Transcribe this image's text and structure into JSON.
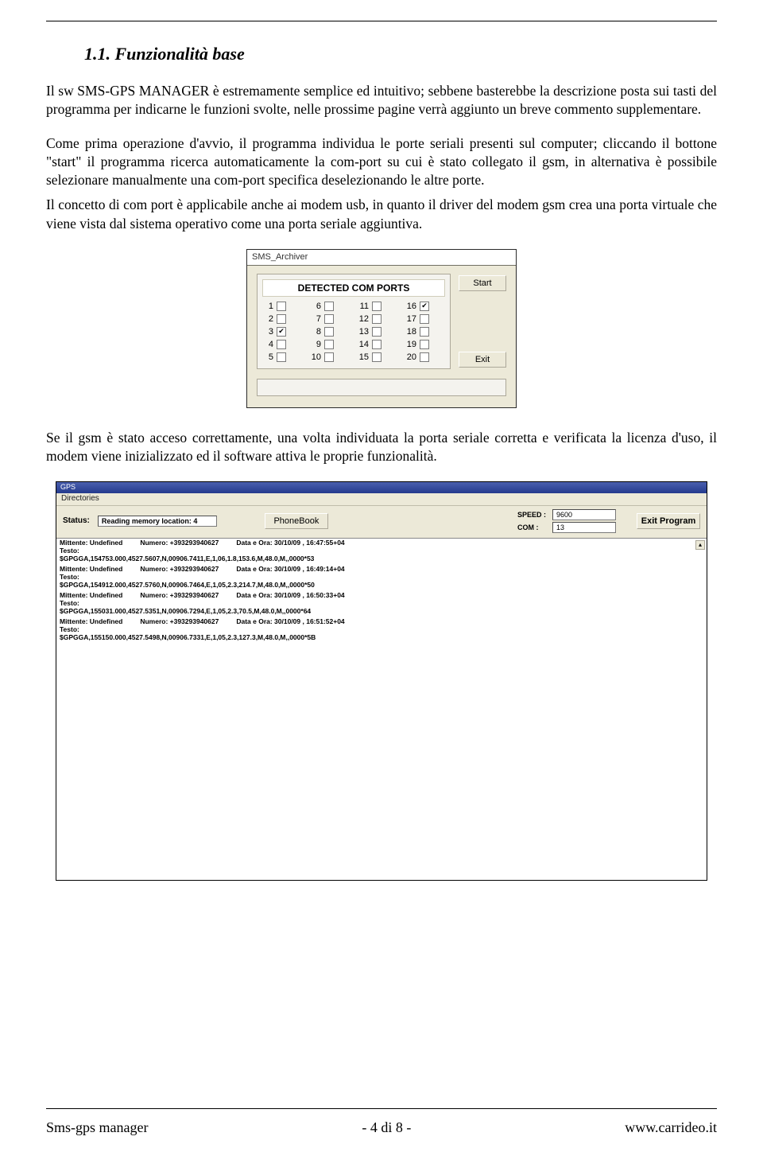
{
  "section": {
    "number": "1.1.",
    "title": "Funzionalità base"
  },
  "paragraphs": {
    "p1": "Il sw SMS-GPS MANAGER è estremamente semplice ed intuitivo; sebbene basterebbe la descrizione posta sui tasti del programma per indicarne le funzioni svolte, nelle prossime pagine verrà aggiunto un breve commento supplementare.",
    "p2": "Come prima operazione d'avvio, il programma individua le porte seriali presenti sul computer; cliccando il bottone \"start\" il programma ricerca automaticamente la com-port su cui è stato collegato il gsm, in alternativa è possibile selezionare manualmente una com-port specifica deselezionando le altre porte.",
    "p3": "Il concetto di com port è applicabile anche ai modem usb, in quanto il driver del modem gsm crea una porta virtuale che viene vista dal sistema operativo come una porta seriale aggiuntiva.",
    "p4": "Se il gsm è stato acceso correttamente, una volta individuata la porta seriale corretta e verificata la licenza d'uso, il modem viene inizializzato ed il software attiva le proprie funzionalità."
  },
  "dlg1": {
    "title": "SMS_Archiver",
    "panel_title": "DETECTED COM PORTS",
    "ports": [
      {
        "n": "1",
        "checked": false
      },
      {
        "n": "6",
        "checked": false
      },
      {
        "n": "11",
        "checked": false
      },
      {
        "n": "16",
        "checked": true
      },
      {
        "n": "2",
        "checked": false
      },
      {
        "n": "7",
        "checked": false
      },
      {
        "n": "12",
        "checked": false
      },
      {
        "n": "17",
        "checked": false
      },
      {
        "n": "3",
        "checked": true
      },
      {
        "n": "8",
        "checked": false
      },
      {
        "n": "13",
        "checked": false
      },
      {
        "n": "18",
        "checked": false
      },
      {
        "n": "4",
        "checked": false
      },
      {
        "n": "9",
        "checked": false
      },
      {
        "n": "14",
        "checked": false
      },
      {
        "n": "19",
        "checked": false
      },
      {
        "n": "5",
        "checked": false
      },
      {
        "n": "10",
        "checked": false
      },
      {
        "n": "15",
        "checked": false
      },
      {
        "n": "20",
        "checked": false
      }
    ],
    "start": "Start",
    "exit": "Exit"
  },
  "dlg2": {
    "title": "GPS",
    "menu": "Directories",
    "status_label": "Status:",
    "status_value": "Reading memory location:  4",
    "phonebook": "PhoneBook",
    "speed_label": "SPEED :",
    "speed_value": "9600",
    "com_label": "COM   :",
    "com_value": "13",
    "exit": "Exit Program",
    "messages": [
      {
        "mittente": "Mittente: Undefined",
        "numero": "Numero: +393293940627",
        "dataora": "Data e Ora: 30/10/09 , 16:47:55+04",
        "testo": "Testo:",
        "gpgga": "$GPGGA,154753.000,4527.5607,N,00906.7411,E,1,06,1.8,153.6,M,48.0,M,,0000*53"
      },
      {
        "mittente": "Mittente: Undefined",
        "numero": "Numero: +393293940627",
        "dataora": "Data e Ora: 30/10/09 , 16:49:14+04",
        "testo": "Testo:",
        "gpgga": "$GPGGA,154912.000,4527.5760,N,00906.7464,E,1,05,2.3,214.7,M,48.0,M,,0000*50"
      },
      {
        "mittente": "Mittente: Undefined",
        "numero": "Numero: +393293940627",
        "dataora": "Data e Ora: 30/10/09 , 16:50:33+04",
        "testo": "Testo:",
        "gpgga": "$GPGGA,155031.000,4527.5351,N,00906.7294,E,1,05,2.3,70.5,M,48.0,M,,0000*64"
      },
      {
        "mittente": "Mittente: Undefined",
        "numero": "Numero: +393293940627",
        "dataora": "Data e Ora: 30/10/09 , 16:51:52+04",
        "testo": "Testo:",
        "gpgga": "$GPGGA,155150.000,4527.5498,N,00906.7331,E,1,05,2.3,127.3,M,48.0,M,,0000*5B"
      }
    ]
  },
  "footer": {
    "left": "Sms-gps manager",
    "center": "- 4 di 8 -",
    "right": "www.carrideo.it"
  }
}
